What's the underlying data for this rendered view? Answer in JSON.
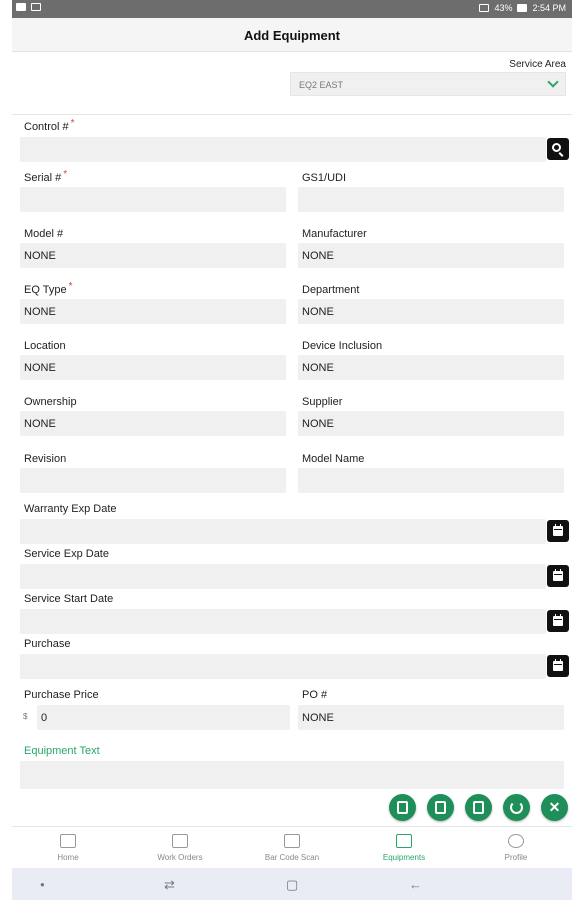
{
  "status_bar": {
    "battery": "43%",
    "time": "2:54 PM"
  },
  "header": {
    "title": "Add Equipment"
  },
  "service_area": {
    "label": "Service Area",
    "value": "EQ2 EAST"
  },
  "fields": {
    "control": {
      "label": "Control #",
      "required": "*",
      "value": ""
    },
    "serial": {
      "label": "Serial #",
      "required": "*",
      "value": ""
    },
    "gs1": {
      "label": "GS1/UDI",
      "value": ""
    },
    "model": {
      "label": "Model #",
      "value": "NONE"
    },
    "manufacturer": {
      "label": "Manufacturer",
      "value": "NONE"
    },
    "eq_type": {
      "label": "EQ Type",
      "required": "*",
      "value": "NONE"
    },
    "department": {
      "label": "Department",
      "value": "NONE"
    },
    "location": {
      "label": "Location",
      "value": "NONE"
    },
    "device_inclusion": {
      "label": "Device Inclusion",
      "value": "NONE"
    },
    "ownership": {
      "label": "Ownership",
      "value": "NONE"
    },
    "supplier": {
      "label": "Supplier",
      "value": "NONE"
    },
    "revision": {
      "label": "Revision",
      "value": ""
    },
    "model_name": {
      "label": "Model Name",
      "value": ""
    },
    "warranty_exp": {
      "label": "Warranty Exp Date",
      "value": ""
    },
    "service_exp": {
      "label": "Service Exp Date",
      "value": ""
    },
    "service_start": {
      "label": "Service Start Date",
      "value": ""
    },
    "purchase": {
      "label": "Purchase",
      "value": ""
    },
    "purchase_price": {
      "label": "Purchase Price",
      "currency": "$",
      "value": "0"
    },
    "po": {
      "label": "PO #",
      "value": "NONE"
    },
    "equipment_text": {
      "label": "Equipment Text",
      "value": ""
    }
  },
  "actions": [
    "add-document-icon",
    "save-icon",
    "copy-icon",
    "refresh-icon",
    "close-icon"
  ],
  "bottom_nav": [
    {
      "label": "Home",
      "icon": "home-icon"
    },
    {
      "label": "Work Orders",
      "icon": "work-orders-icon"
    },
    {
      "label": "Bar Code Scan",
      "icon": "barcode-icon"
    },
    {
      "label": "Equipments",
      "icon": "equipments-icon",
      "active": true
    },
    {
      "label": "Profile",
      "icon": "profile-icon"
    }
  ],
  "colors": {
    "accent": "#2ba56a",
    "fab": "#1f8f5a",
    "required": "#e53935",
    "field_bg": "#f0f0f0"
  }
}
